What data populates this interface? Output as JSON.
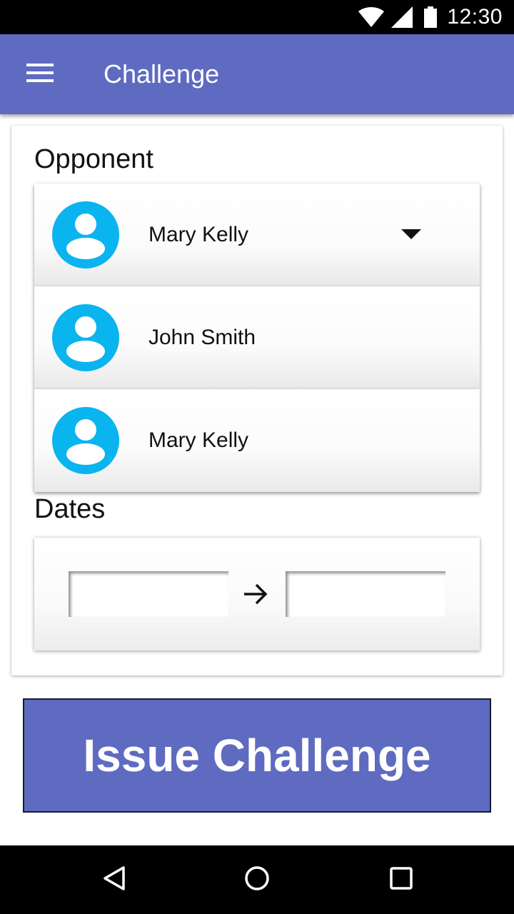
{
  "status_bar": {
    "time": "12:30",
    "icons": [
      "wifi-icon",
      "signal-icon",
      "battery-icon"
    ]
  },
  "app_bar": {
    "title": "Challenge",
    "menu_icon": "hamburger-menu-icon",
    "color": "#5f6bc0"
  },
  "opponent": {
    "label": "Opponent",
    "selected": "Mary Kelly",
    "options": [
      {
        "name": "John Smith",
        "icon": "avatar-icon"
      },
      {
        "name": "Mary Kelly",
        "icon": "avatar-icon"
      }
    ],
    "avatar_color": "#0ab4ee"
  },
  "dates": {
    "label": "Dates",
    "start_value": "",
    "end_value": "",
    "separator_icon": "arrow-right-icon"
  },
  "issue_button": {
    "label": "Issue Challenge",
    "color": "#5f6bc0"
  },
  "nav_bar": {
    "icons": [
      "back-triangle-icon",
      "home-circle-icon",
      "recents-square-icon"
    ]
  }
}
